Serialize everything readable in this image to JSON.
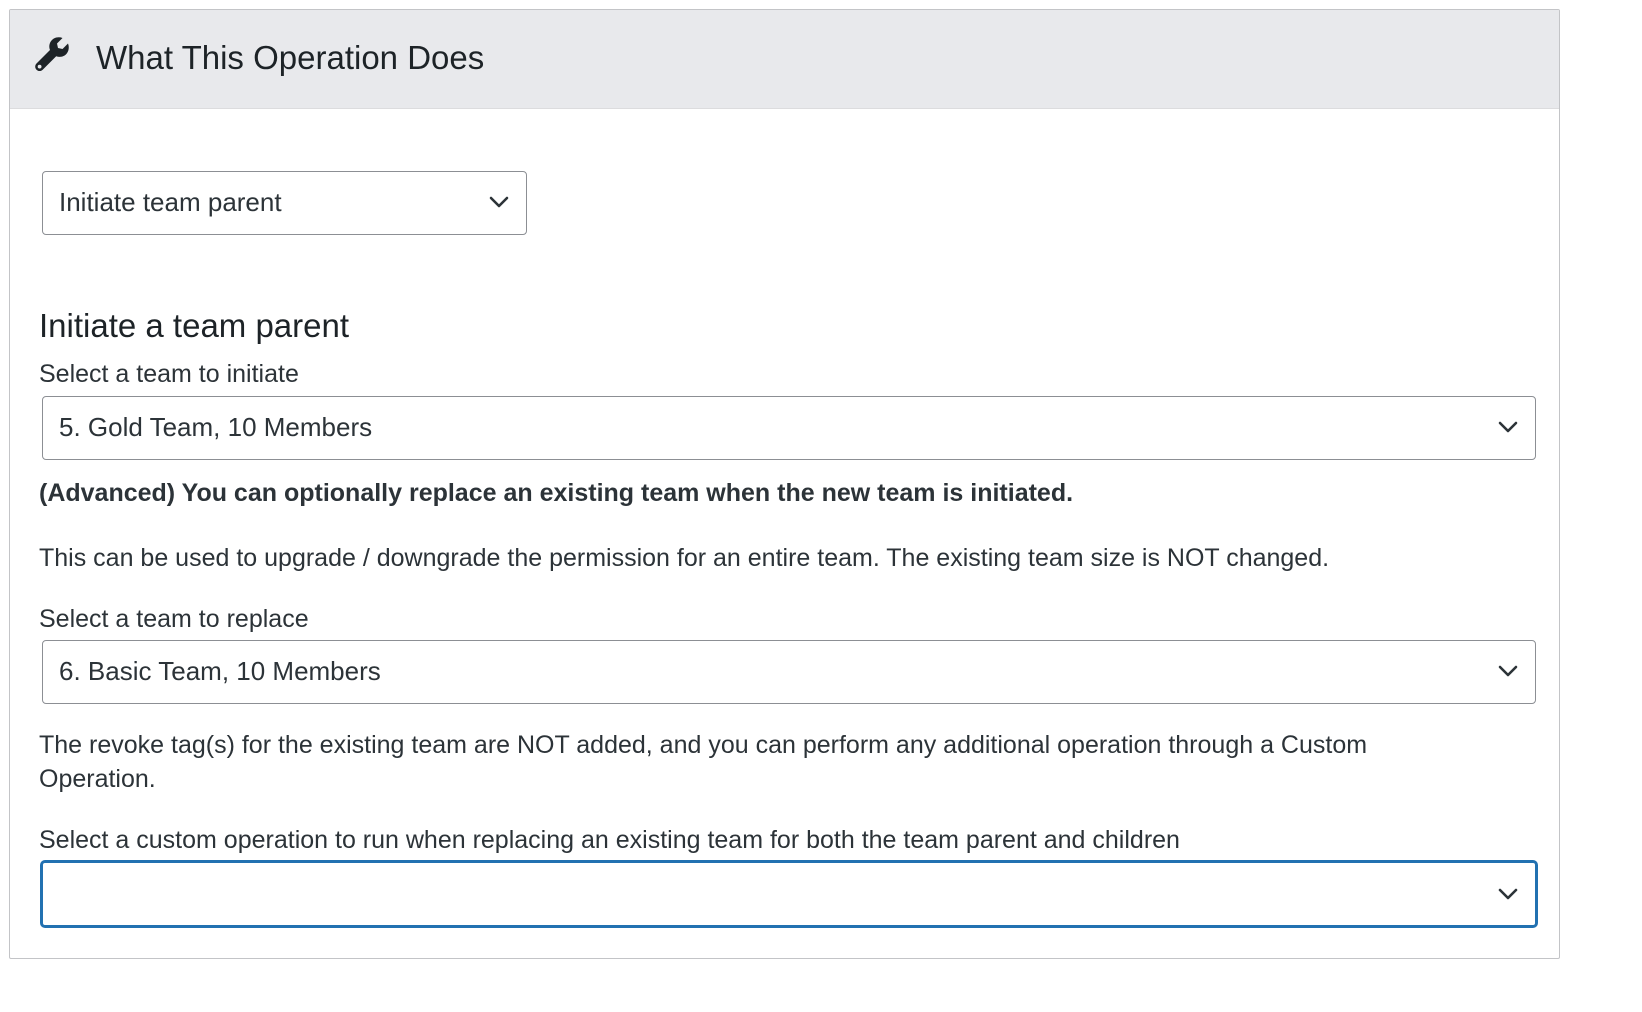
{
  "header": {
    "title": "What This Operation Does",
    "icon": "wrench-icon"
  },
  "operation_select": {
    "value": "Initiate team parent"
  },
  "section": {
    "heading": "Initiate a team parent"
  },
  "initiate_team": {
    "label": "Select a team to initiate",
    "value": "5. Gold Team, 10 Members"
  },
  "advanced_note": "(Advanced) You can optionally replace an existing team when the new team is initiated.",
  "upgrade_note": "This can be used to upgrade / downgrade the permission for an entire team. The existing team size is NOT changed.",
  "replace_team": {
    "label": "Select a team to replace",
    "value": "6. Basic Team, 10 Members"
  },
  "revoke_note": "The revoke tag(s) for the existing team are NOT added, and you can perform any additional operation through a Custom Operation.",
  "custom_operation": {
    "label": "Select a custom operation to run when replacing an existing team for both the team parent and children",
    "value": ""
  },
  "colors": {
    "header_bg": "#e8e9ec",
    "focus_border": "#2271b1",
    "text": "#2c3338"
  }
}
